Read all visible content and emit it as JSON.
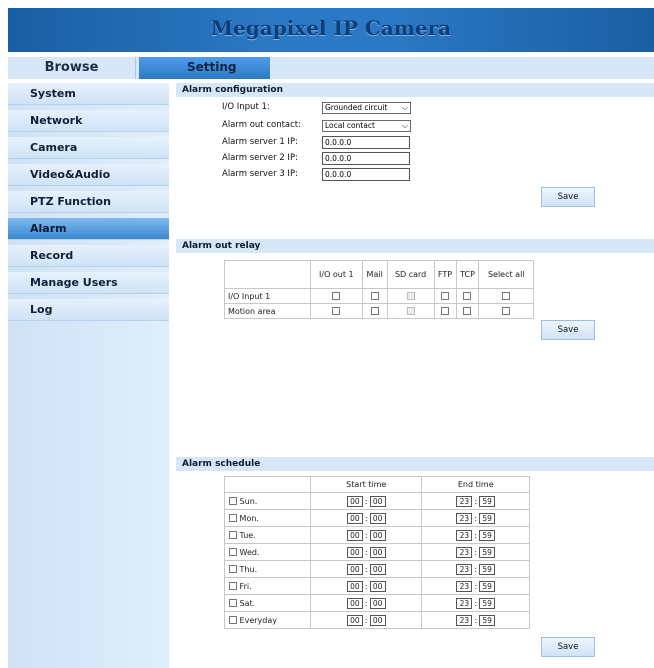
{
  "header": {
    "title": "Megapixel IP Camera"
  },
  "tabs": {
    "browse": "Browse",
    "setting": "Setting"
  },
  "sidebar": {
    "items": [
      {
        "label": "System"
      },
      {
        "label": "Network"
      },
      {
        "label": "Camera"
      },
      {
        "label": "Video&Audio"
      },
      {
        "label": "PTZ Function"
      },
      {
        "label": "Alarm"
      },
      {
        "label": "Record"
      },
      {
        "label": "Manage Users"
      },
      {
        "label": "Log"
      }
    ],
    "active": "Alarm"
  },
  "alarm_config": {
    "title": "Alarm configuration",
    "io_input_label": "I/O Input 1:",
    "io_input_value": "Grounded circuit",
    "alarm_out_label": "Alarm out contact:",
    "alarm_out_value": "Local contact",
    "server1_label": "Alarm server 1 IP:",
    "server1_value": "0.0.0.0",
    "server2_label": "Alarm server 2 IP:",
    "server2_value": "0.0.0.0",
    "server3_label": "Alarm server 3 IP:",
    "server3_value": "0.0.0.0",
    "save": "Save"
  },
  "alarm_relay": {
    "title": "Alarm out relay",
    "headers": [
      "I/O out 1",
      "Mail",
      "SD card",
      "FTP",
      "TCP",
      "Select all"
    ],
    "rows": [
      {
        "label": "I/O Input 1"
      },
      {
        "label": "Motion area"
      }
    ],
    "save": "Save"
  },
  "alarm_schedule": {
    "title": "Alarm schedule",
    "start_header": "Start time",
    "end_header": "End time",
    "colon": ":",
    "rows": [
      {
        "day": "Sun.",
        "sh": "00",
        "sm": "00",
        "eh": "23",
        "em": "59"
      },
      {
        "day": "Mon.",
        "sh": "00",
        "sm": "00",
        "eh": "23",
        "em": "59"
      },
      {
        "day": "Tue.",
        "sh": "00",
        "sm": "00",
        "eh": "23",
        "em": "59"
      },
      {
        "day": "Wed.",
        "sh": "00",
        "sm": "00",
        "eh": "23",
        "em": "59"
      },
      {
        "day": "Thu.",
        "sh": "00",
        "sm": "00",
        "eh": "23",
        "em": "59"
      },
      {
        "day": "Fri.",
        "sh": "00",
        "sm": "00",
        "eh": "23",
        "em": "59"
      },
      {
        "day": "Sat.",
        "sh": "00",
        "sm": "00",
        "eh": "23",
        "em": "59"
      },
      {
        "day": "Everyday",
        "sh": "00",
        "sm": "00",
        "eh": "23",
        "em": "59"
      }
    ],
    "save": "Save"
  }
}
